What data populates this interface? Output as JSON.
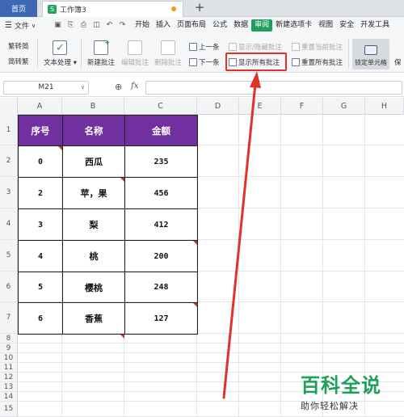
{
  "titlebar": {
    "home_tab": "首页",
    "doc_tab": "工作簿3",
    "add_tab": "+"
  },
  "menubar": {
    "file": "文件",
    "items": [
      "开始",
      "插入",
      "页面布局",
      "公式",
      "数据",
      "审阅",
      "新建选项卡",
      "视图",
      "安全",
      "开发工具"
    ],
    "active": "审阅"
  },
  "ribbon": {
    "trad_to_simp": "繁转简",
    "simp_to_trad": "简转繁",
    "text_process": "文本处理",
    "new_comment": "新建批注",
    "edit_comment": "编辑批注",
    "delete_comment": "删除批注",
    "prev": "上一条",
    "next": "下一条",
    "show_hide_comment": "显示/隐藏批注",
    "show_all_comments": "显示所有批注",
    "reset_current_comment": "重置当前批注",
    "reset_all_comments": "重置所有批注",
    "lock_cell": "锁定单元格",
    "protect": "保"
  },
  "formula_bar": {
    "cell_ref": "M21",
    "fx": "fx",
    "value": ""
  },
  "grid": {
    "columns": [
      "A",
      "B",
      "C",
      "D",
      "E",
      "F",
      "G",
      "H"
    ],
    "rows": [
      "1",
      "2",
      "3",
      "4",
      "5",
      "6",
      "7",
      "8",
      "9",
      "10",
      "11",
      "12",
      "13",
      "14",
      "15"
    ]
  },
  "table": {
    "headers": [
      "序号",
      "名称",
      "金额"
    ],
    "rows": [
      [
        "0",
        "西瓜",
        "235"
      ],
      [
        "2",
        "苹，果",
        "456"
      ],
      [
        "3",
        "梨",
        "412"
      ],
      [
        "4",
        "桃",
        "200"
      ],
      [
        "5",
        "樱桃",
        "248"
      ],
      [
        "6",
        "香蕉",
        "127"
      ]
    ]
  },
  "watermark": {
    "title": "百科全说",
    "subtitle": "助你轻松解决"
  },
  "colors": {
    "header_fill": "#7030a0",
    "active_tab": "#1f9e60",
    "highlight": "#e0322b",
    "brand_blue": "#3d68b3"
  }
}
